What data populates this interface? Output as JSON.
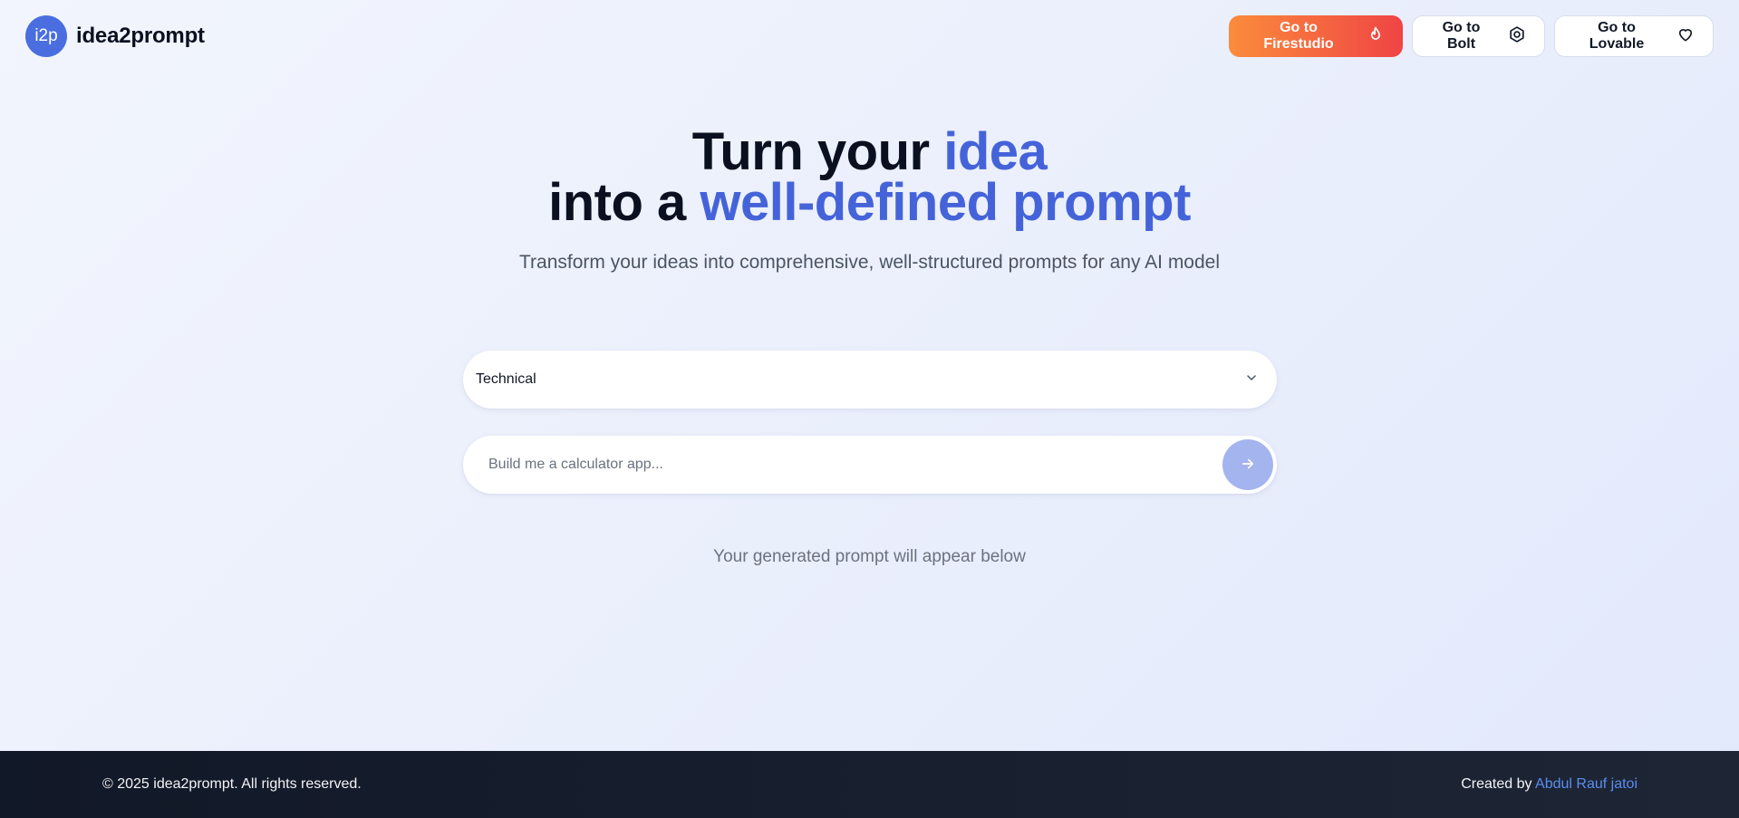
{
  "brand": {
    "logo_text": "i2p",
    "name": "idea2prompt"
  },
  "nav": {
    "firestudio_label": "Go to Firestudio",
    "bolt_label": "Go to Bolt",
    "lovable_label": "Go to Lovable"
  },
  "hero": {
    "title_line1_prefix": "Turn your ",
    "title_line1_accent": "idea",
    "title_line2_prefix": "into a ",
    "title_line2_accent": "well-defined prompt",
    "subtitle": "Transform your ideas into comprehensive, well-structured prompts for any AI model"
  },
  "form": {
    "category_selected": "Technical",
    "prompt_value": "",
    "prompt_placeholder": "Build me a calculator app..."
  },
  "output": {
    "placeholder": "Your generated prompt will appear below"
  },
  "footer": {
    "copyright": "© 2025 idea2prompt. All rights reserved.",
    "created_by": "Created by ",
    "author": "Abdul Rauf jatoi"
  },
  "icons": {
    "firestudio": "flame-icon",
    "bolt": "hexagon-gear-icon",
    "lovable": "heart-icon",
    "select": "chevron-down-icon",
    "submit": "arrow-right-icon"
  },
  "colors": {
    "accent": "#4563d9",
    "logo": "#4a6ee0",
    "primary_gradient_start": "#fb8c3c",
    "primary_gradient_end": "#ef4444",
    "submit_button": "#a4b4ee",
    "footer_bg": "#111827",
    "author_link": "#5b8def"
  }
}
